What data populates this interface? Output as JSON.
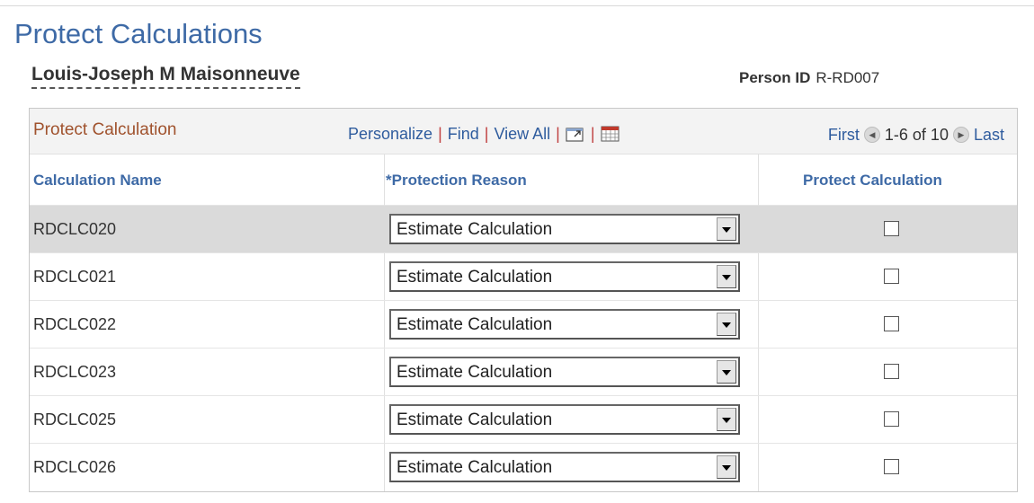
{
  "page": {
    "title": "Protect Calculations"
  },
  "person": {
    "name": "Louis-Joseph M Maisonneuve",
    "id_label": "Person ID",
    "id_value": "R-RD007"
  },
  "grid": {
    "title": "Protect Calculation",
    "tools": {
      "personalize": "Personalize",
      "find": "Find",
      "view_all": "View All",
      "separator": "|"
    },
    "icons": {
      "zoom": "new-window-icon",
      "download": "download-grid-icon",
      "prev": "previous-arrow-icon",
      "next": "next-arrow-icon"
    },
    "nav": {
      "first": "First",
      "count": "1-6 of 10",
      "last": "Last"
    },
    "columns": {
      "name": "Calculation Name",
      "reason": "*Protection Reason",
      "protect": "Protect Calculation"
    },
    "rows": [
      {
        "name": "RDCLC020",
        "reason": "Estimate Calculation",
        "protect": false
      },
      {
        "name": "RDCLC021",
        "reason": "Estimate Calculation",
        "protect": false
      },
      {
        "name": "RDCLC022",
        "reason": "Estimate Calculation",
        "protect": false
      },
      {
        "name": "RDCLC023",
        "reason": "Estimate Calculation",
        "protect": false
      },
      {
        "name": "RDCLC025",
        "reason": "Estimate Calculation",
        "protect": false
      },
      {
        "name": "RDCLC026",
        "reason": "Estimate Calculation",
        "protect": false
      }
    ]
  },
  "colors": {
    "title": "#3e6aa6",
    "grid_title": "#a0522d",
    "link": "#2f5c9e",
    "selected_row": "#dadada"
  }
}
